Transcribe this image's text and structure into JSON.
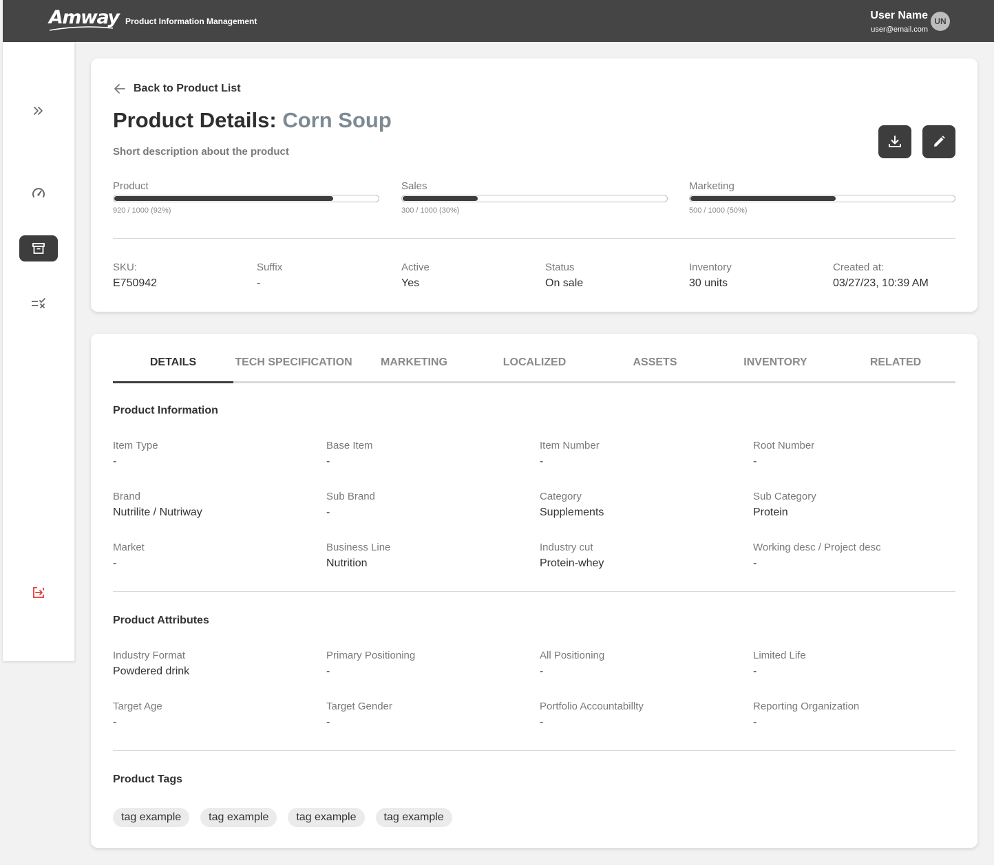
{
  "header": {
    "logo_text": "Amway",
    "app_title": "Product Information Management",
    "user_name": "User Name",
    "user_email": "user@email.com",
    "avatar_initials": "UN"
  },
  "sidebar": {
    "items": [
      {
        "icon": "double-chevron-right-icon",
        "active": false
      },
      {
        "icon": "speedometer-icon",
        "active": false
      },
      {
        "icon": "archive-box-icon",
        "active": true
      },
      {
        "icon": "checklist-icon",
        "active": false
      },
      {
        "icon": "logout-icon",
        "active": false,
        "color": "#e53935"
      }
    ]
  },
  "product": {
    "back_label": "Back to Product List",
    "title_prefix": "Product Details:",
    "name": "Corn Soup",
    "description": "Short description about the product",
    "progress": [
      {
        "label": "Product",
        "count": "920 / 1000 (92%)",
        "fraction": 0.83
      },
      {
        "label": "Sales",
        "count": "300 / 1000 (30%)",
        "fraction": 0.285
      },
      {
        "label": "Marketing",
        "count": "500 / 1000 (50%)",
        "fraction": 0.55
      }
    ],
    "meta": [
      {
        "label": "SKU:",
        "value": "E750942"
      },
      {
        "label": "Suffix",
        "value": "-"
      },
      {
        "label": "Active",
        "value": "Yes"
      },
      {
        "label": "Status",
        "value": "On sale"
      },
      {
        "label": "Inventory",
        "value": "30 units"
      },
      {
        "label": "Created at:",
        "value": "03/27/23, 10:39 AM"
      }
    ]
  },
  "tabs": [
    "DETAILS",
    "TECH SPECIFICATION",
    "MARKETING",
    "LOCALIZED",
    "ASSETS",
    "INVENTORY",
    "RELATED"
  ],
  "active_tab": "DETAILS",
  "product_information": {
    "title": "Product Information",
    "fields": [
      {
        "label": "Item Type",
        "value": "-"
      },
      {
        "label": "Base Item",
        "value": "-"
      },
      {
        "label": "Item Number",
        "value": "-"
      },
      {
        "label": "Root Number",
        "value": "-"
      },
      {
        "label": "Brand",
        "value": "Nutrilite / Nutriway"
      },
      {
        "label": "Sub Brand",
        "value": "-"
      },
      {
        "label": "Category",
        "value": "Supplements"
      },
      {
        "label": "Sub Category",
        "value": "Protein"
      },
      {
        "label": "Market",
        "value": "-"
      },
      {
        "label": "Business Line",
        "value": "Nutrition"
      },
      {
        "label": "Industry cut",
        "value": "Protein-whey"
      },
      {
        "label": "Working desc / Project desc",
        "value": "-"
      }
    ]
  },
  "product_attributes": {
    "title": "Product Attributes",
    "fields": [
      {
        "label": "Industry Format",
        "value": "Powdered drink"
      },
      {
        "label": "Primary Positioning",
        "value": "-"
      },
      {
        "label": "All Positioning",
        "value": "-"
      },
      {
        "label": "Limited Life",
        "value": "-"
      },
      {
        "label": "Target Age",
        "value": "-"
      },
      {
        "label": "Target Gender",
        "value": "-"
      },
      {
        "label": "Portfolio Accountabillty",
        "value": "-"
      },
      {
        "label": "Reporting Organization",
        "value": "-"
      }
    ]
  },
  "product_tags": {
    "title": "Product Tags",
    "tags": [
      "tag example",
      "tag example",
      "tag example",
      "tag example"
    ]
  }
}
